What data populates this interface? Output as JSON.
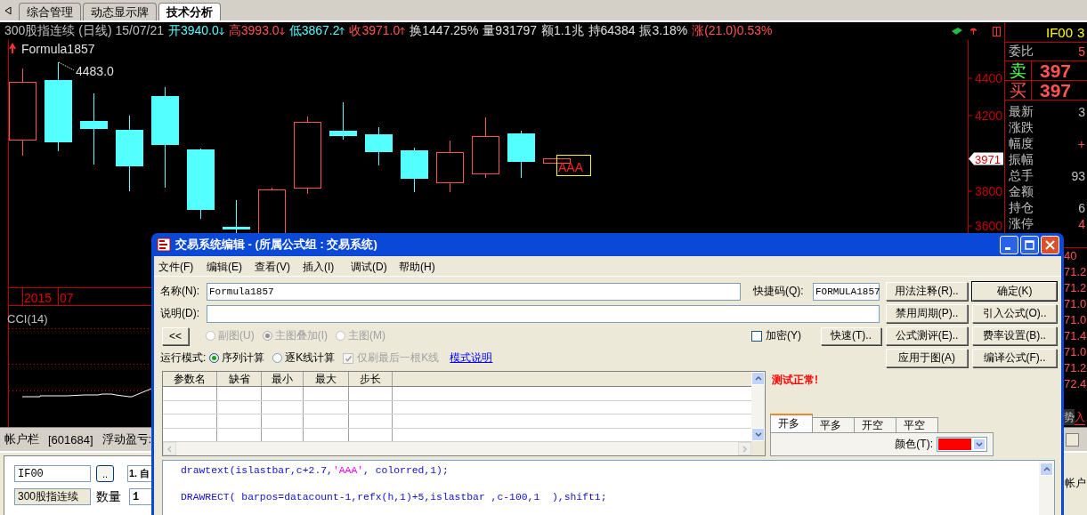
{
  "tabs": [
    {
      "label": "综合管理",
      "selected": false
    },
    {
      "label": "动态显示牌",
      "selected": false
    },
    {
      "label": "技术分析",
      "selected": true
    }
  ],
  "quote": {
    "segments": [
      {
        "text": "300股指连续 (日线) 15/07/21",
        "color": "#c0c0c0"
      },
      {
        "text": "开3940.0",
        "color": "#54ffff",
        "rising": false
      },
      {
        "text": "高3993.0",
        "color": "#ff5454",
        "rising": false
      },
      {
        "text": "低3867.2",
        "color": "#54ffff",
        "rising": true
      },
      {
        "text": "收3971.0",
        "color": "#ff5454",
        "rising": true
      },
      {
        "text": "换1447.25%",
        "color": "#e0e0e0"
      },
      {
        "text": "量931797",
        "color": "#e0e0e0"
      },
      {
        "text": "额1.1兆",
        "color": "#e0e0e0"
      },
      {
        "text": "持64384",
        "color": "#e0e0e0"
      },
      {
        "text": "振3.18%",
        "color": "#e0e0e0"
      },
      {
        "text": "涨(21.0)0.53%",
        "color": "#ff5454"
      }
    ]
  },
  "chart": {
    "formula": "Formula1857",
    "high_label": "4483.0",
    "marker_text": "AAA",
    "axis_labels": [
      "4400",
      "4200",
      "3800",
      "3600"
    ],
    "price_tag": "3971",
    "dates": [
      "2015",
      "07"
    ],
    "indicator": "CCI(14)"
  },
  "quote_panel": {
    "symbol": "IF00",
    "symbol_tail": "3",
    "rows": [
      {
        "kind": "plain",
        "label": "委比",
        "value": "5",
        "color": "#ff5454"
      },
      {
        "kind": "big",
        "label": "卖",
        "value": "397",
        "color": "#54ff54"
      },
      {
        "kind": "big",
        "label": "买",
        "value": "397",
        "color": "#ff5454"
      },
      {
        "kind": "plain",
        "label": "最新",
        "value": "3",
        "color": "#c0c0c0"
      },
      {
        "kind": "plain",
        "label": "涨跌"
      },
      {
        "kind": "plain",
        "label": "幅度",
        "value": "+",
        "color": "#ff5454"
      },
      {
        "kind": "plain",
        "label": "振幅"
      },
      {
        "kind": "plain",
        "label": "总手",
        "value": "93",
        "color": "#c0c0c0"
      },
      {
        "kind": "plain",
        "label": "金额"
      },
      {
        "kind": "plain",
        "label": "持仓",
        "value": "6",
        "color": "#c0c0c0"
      },
      {
        "kind": "plain",
        "label": "涨停",
        "value": "4",
        "color": "#ff5454"
      }
    ],
    "depth_header": "40",
    "ticks": [
      "71.2",
      "71.2",
      "71.0",
      "71.0",
      "71.4",
      "71.0",
      "71.2",
      "72.4"
    ],
    "strip_tabs": [
      {
        "label": "势",
        "selected": false
      },
      {
        "label": "入",
        "selected": true
      }
    ]
  },
  "account_bar": {
    "label": "帐户栏",
    "account": "[601684]",
    "pnl_label": "浮动盈亏:",
    "tail": "帐户"
  },
  "order_form": {
    "symbol": "IF00",
    "browse": "..",
    "order_type": "1. 自",
    "name": "300股指连续",
    "qty_label": "数量",
    "qty": "1"
  },
  "dialog": {
    "title": "交易系统编辑 - (所属公式组 : 交易系统)",
    "menu": [
      "文件(F)",
      "编辑(E)",
      "查看(V)",
      "插入(I)",
      "调试(D)",
      "帮助(H)"
    ],
    "name_label": "名称(N):",
    "name_value": "Formula1857",
    "shortcut_label": "快捷码(Q):",
    "shortcut_value": "FORMULA1857",
    "desc_label": "说明(D):",
    "collapse_button": "<<",
    "chart_modes": [
      {
        "label": "副图(U)",
        "selected": false,
        "disabled": true
      },
      {
        "label": "主图叠加(I)",
        "selected": true,
        "disabled": true
      },
      {
        "label": "主图(M)",
        "selected": false,
        "disabled": true
      }
    ],
    "encrypt": {
      "label": "加密(Y)",
      "checked": false
    },
    "quick_button": "快速(T)..",
    "run_mode_label": "运行模式:",
    "run_modes": [
      {
        "label": "序列计算",
        "selected": true
      },
      {
        "label": "逐K线计算",
        "selected": false
      }
    ],
    "refresh_last": {
      "label": "仅刷最后一根K线",
      "checked": true,
      "disabled": true
    },
    "mode_help_link": "模式说明",
    "side_buttons": [
      {
        "label": "用法注释(R)..",
        "default": false
      },
      {
        "label": "确定(K)",
        "default": true
      },
      {
        "label": "禁用周期(P)..",
        "default": false
      },
      {
        "label": "引入公式(O)..",
        "default": false
      },
      {
        "label": "公式测评(E)..",
        "default": false
      },
      {
        "label": "费率设置(B)..",
        "default": false
      },
      {
        "label": "应用于图(A)",
        "default": false
      },
      {
        "label": "编译公式(F)..",
        "default": false
      }
    ],
    "param_columns": [
      "参数名",
      "缺省",
      "最小",
      "最大",
      "步长"
    ],
    "status": "测试正常!",
    "signal_tabs": [
      {
        "label": "开多",
        "selected": true
      },
      {
        "label": "平多",
        "selected": false
      },
      {
        "label": "开空",
        "selected": false
      },
      {
        "label": "平空",
        "selected": false
      }
    ],
    "color_picker": {
      "label": "颜色(T):",
      "color": "#ff0000"
    },
    "code_lines": [
      {
        "kind": "code",
        "segments": [
          {
            "kind": "code",
            "text": "drawtext(islastbar,c+2.7,"
          },
          {
            "kind": "string",
            "text": "'AAA'"
          },
          {
            "kind": "code",
            "text": ", colorred,1);"
          }
        ]
      },
      {
        "kind": "blank"
      },
      {
        "kind": "code",
        "segments": [
          {
            "kind": "code",
            "text": "DRAWRECT( barpos=datacount-1,refx(h,1)+5,islastbar ,c-100,1  ),shift1;"
          }
        ]
      }
    ]
  }
}
